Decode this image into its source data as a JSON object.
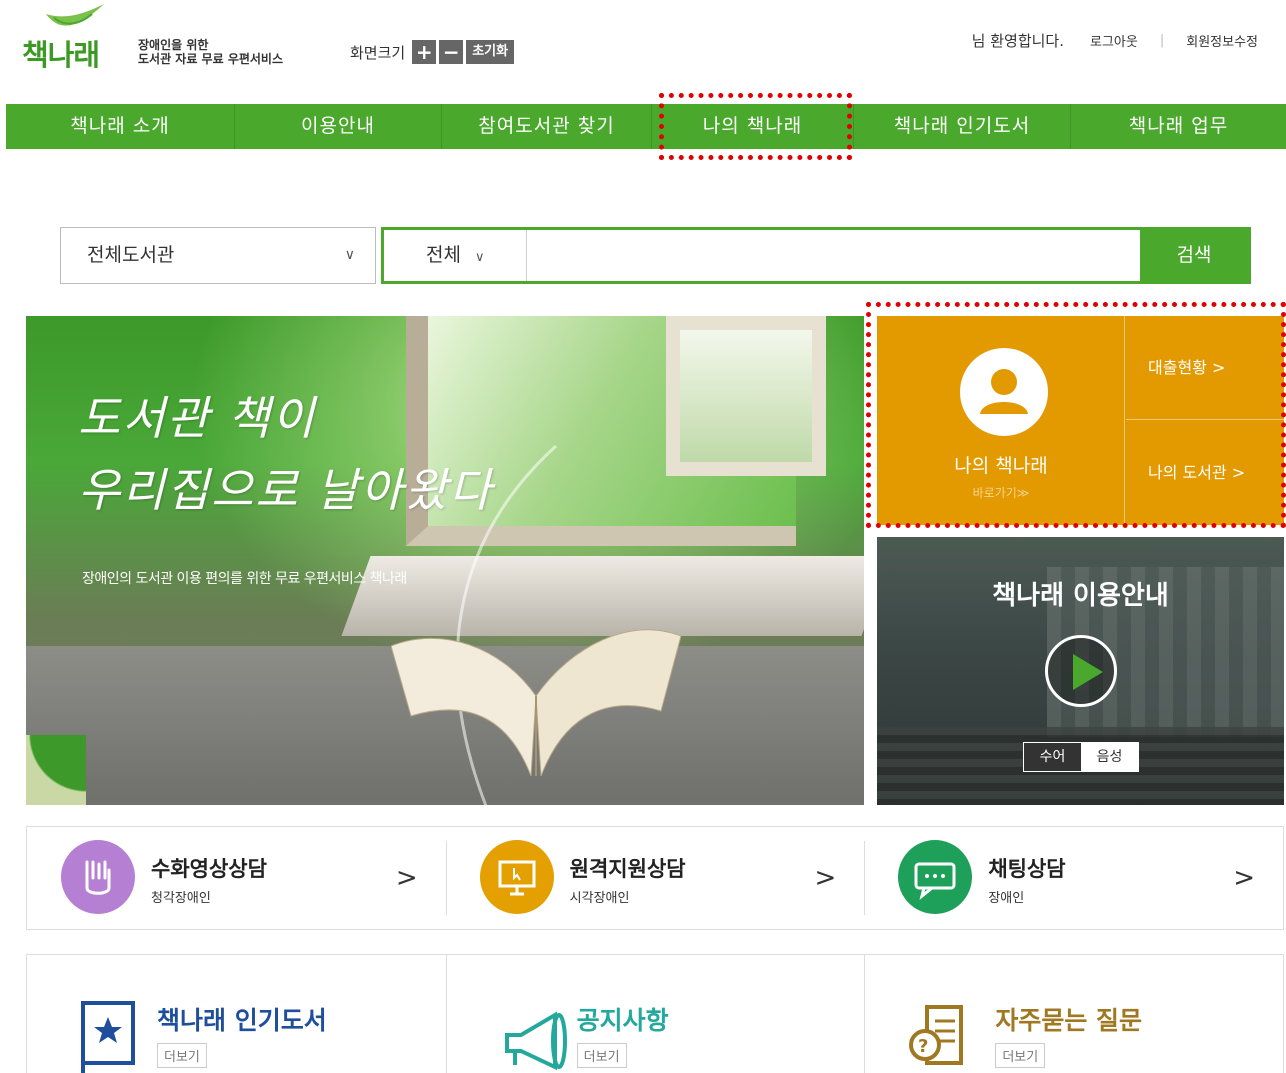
{
  "header": {
    "logo_text": "책나래",
    "tagline_line1": "장애인을 위한",
    "tagline_line2": "도서관 자료 무료 우편서비스",
    "font_size_label": "화면크기",
    "font_plus": "+",
    "font_minus": "−",
    "font_reset": "초기화",
    "welcome": "님 환영합니다.",
    "logout": "로그아웃",
    "separator": "|",
    "edit_profile": "회원정보수정"
  },
  "nav": {
    "items": [
      {
        "label": "책나래 소개"
      },
      {
        "label": "이용안내"
      },
      {
        "label": "참여도서관 찾기"
      },
      {
        "label": "나의 책나래"
      },
      {
        "label": "책나래 인기도서"
      },
      {
        "label": "책나래 업무"
      }
    ]
  },
  "search": {
    "library_select": "전체도서관",
    "category_select": "전체",
    "query": "",
    "button": "검색"
  },
  "banner": {
    "calligraphy_line1": "도서관 책이",
    "calligraphy_line2": "우리집으로 날아왔다",
    "subtitle": "장애인의 도서관 이용 편의를 위한 무료 우편서비스 책나래"
  },
  "my_box": {
    "title": "나의 책나래",
    "shortcut": "바로가기≫",
    "loan_status": "대출현황 >",
    "my_library": "나의 도서관 >"
  },
  "guide": {
    "title": "책나래 이용안내",
    "tab_sign": "수어",
    "tab_voice": "음성"
  },
  "consult": {
    "items": [
      {
        "title": "수화영상상담",
        "sub": "청각장애인",
        "icon": "hand-sign-icon",
        "color": "#b57fd4"
      },
      {
        "title": "원격지원상담",
        "sub": "시각장애인",
        "icon": "monitor-cursor-icon",
        "color": "#e3a000"
      },
      {
        "title": "채팅상담",
        "sub": "장애인",
        "icon": "chat-bubble-icon",
        "color": "#1fa05a"
      }
    ],
    "arrow": ">"
  },
  "boxes": {
    "items": [
      {
        "title": "책나래 인기도서",
        "more": "더보기",
        "icon": "star-book-icon",
        "color": "#1f4f9c"
      },
      {
        "title": "공지사항",
        "more": "더보기",
        "icon": "megaphone-icon",
        "color": "#23a89c"
      },
      {
        "title": "자주묻는 질문",
        "more": "더보기",
        "icon": "faq-document-icon",
        "color": "#a07822"
      }
    ]
  },
  "colors": {
    "brand_green": "#4aa82c",
    "my_box_orange": "#e39a00",
    "highlight_red": "#e00000"
  }
}
